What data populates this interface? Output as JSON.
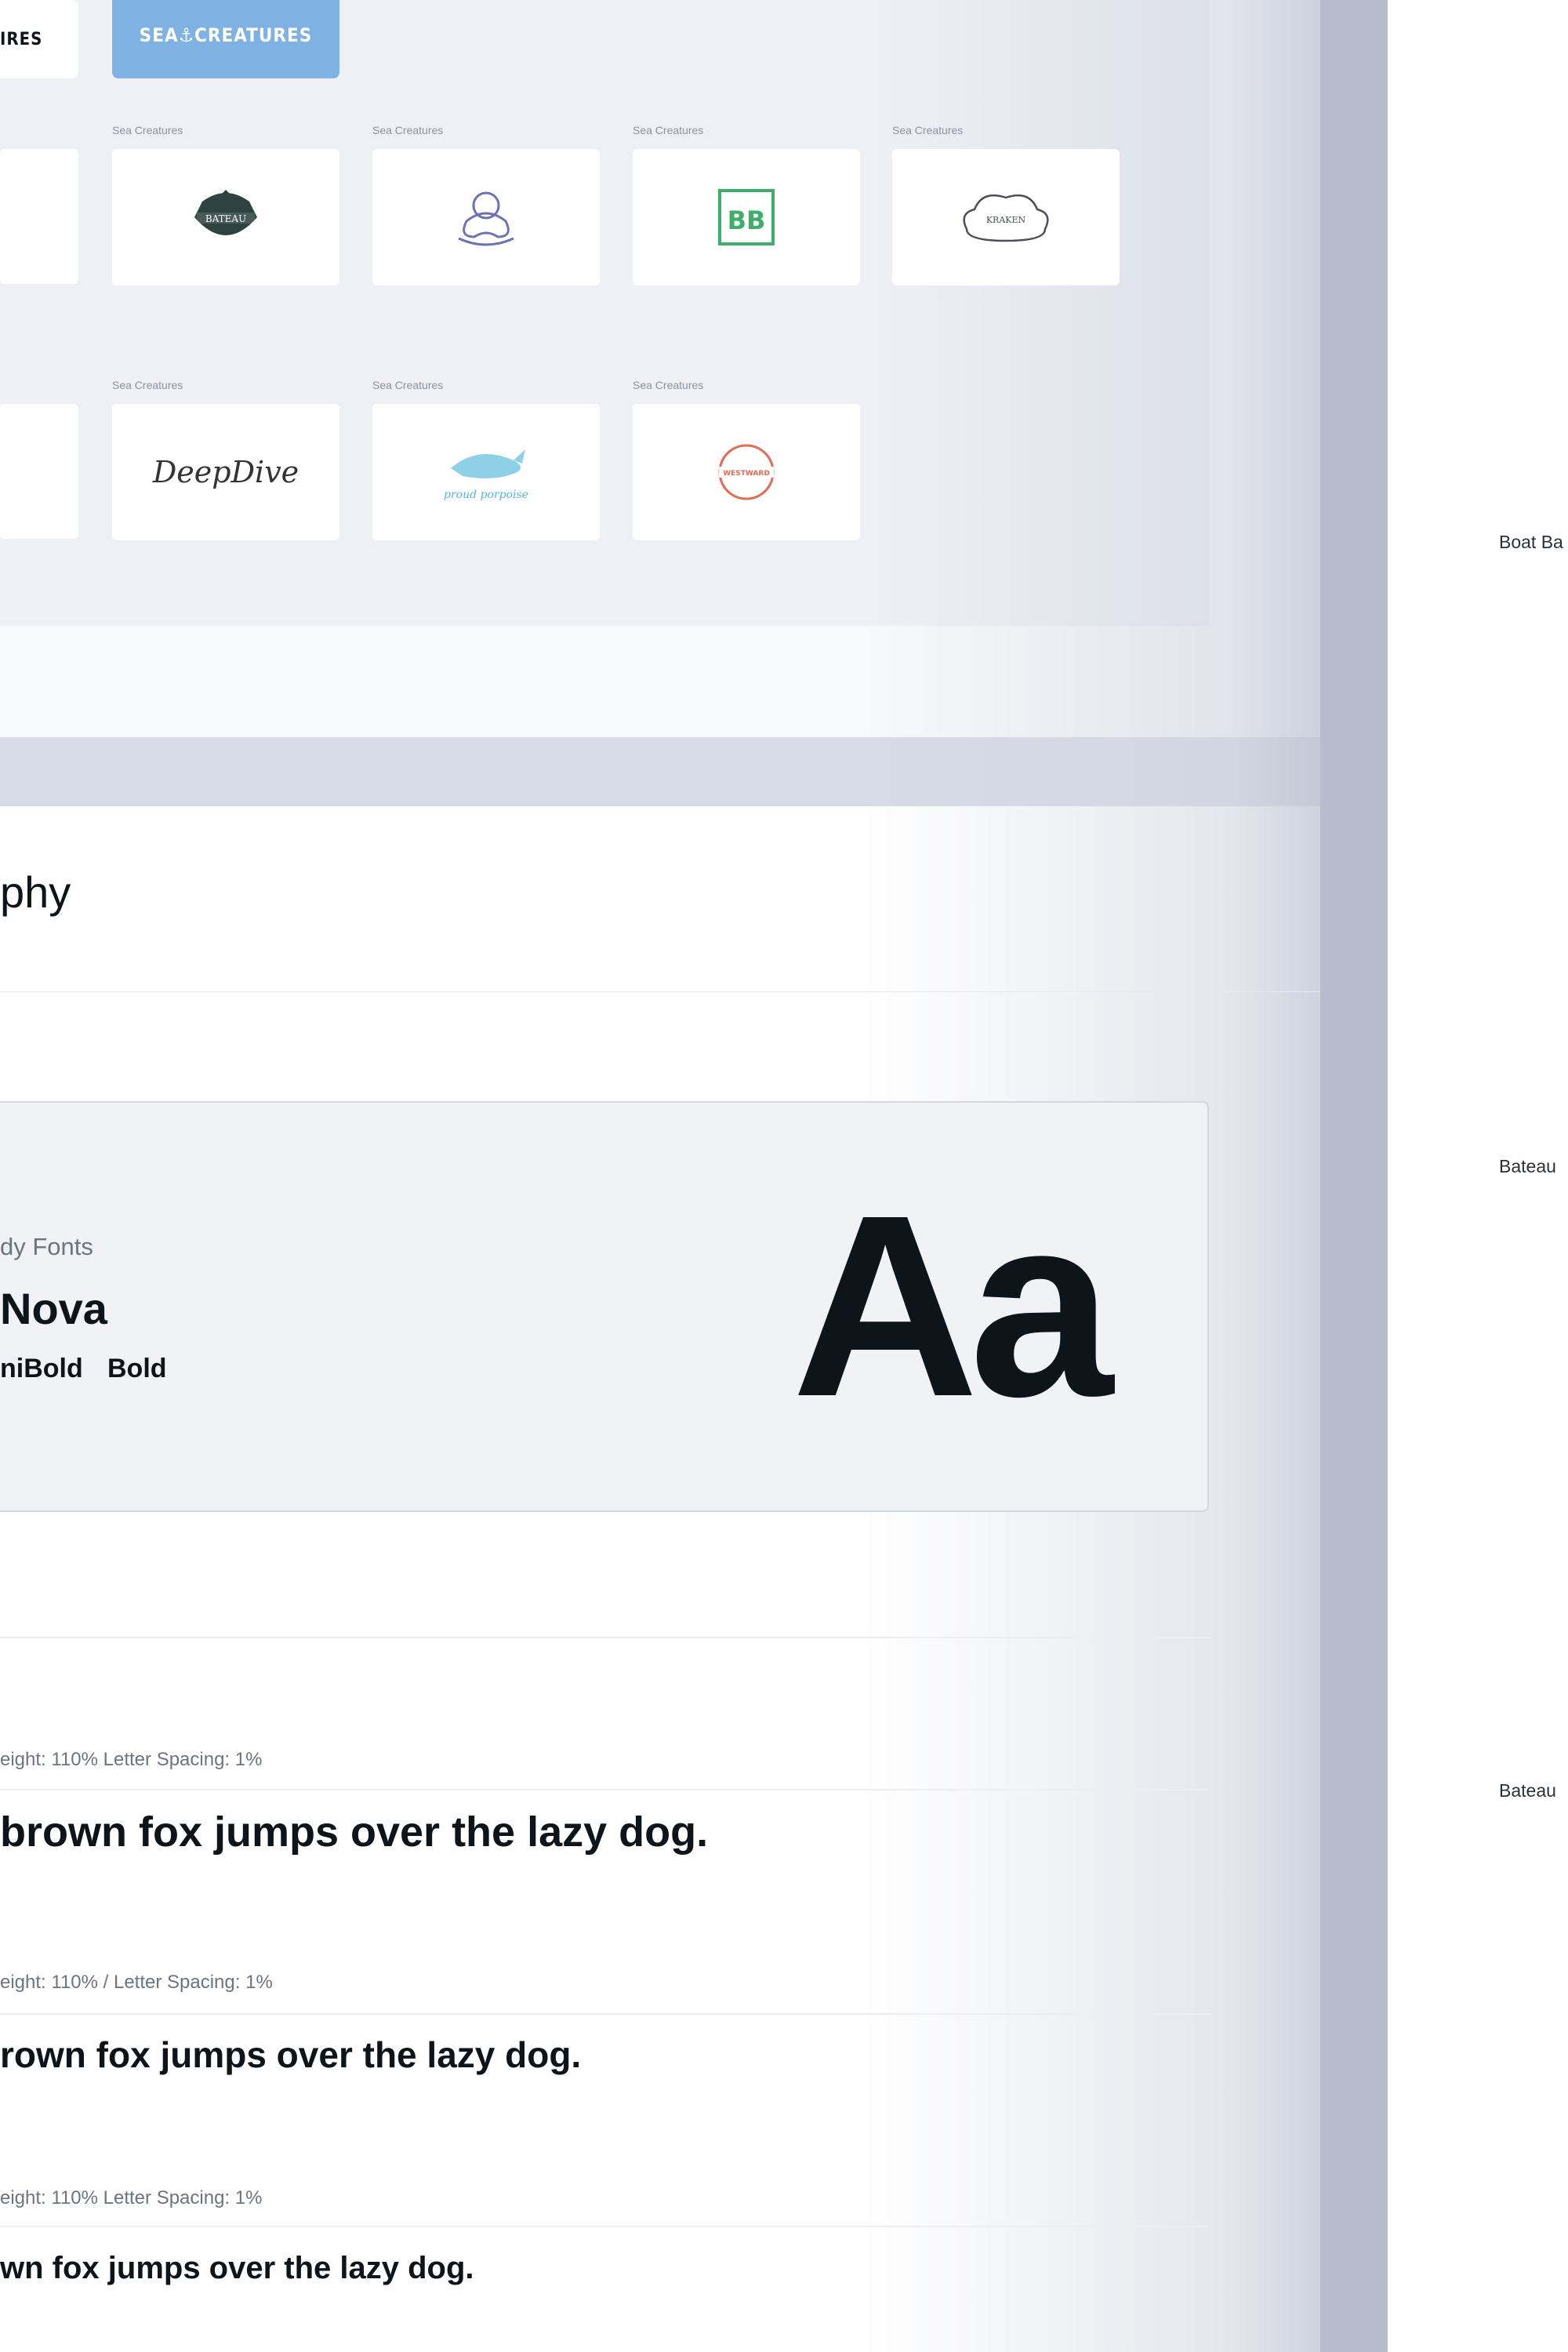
{
  "logos": {
    "tabs": {
      "previous": "IRES",
      "active": "SEA⚓CREATURES"
    },
    "row1": [
      {
        "label": "Sea Creatures",
        "logo": "BATEAU"
      },
      {
        "label": "Sea Creatures",
        "logo": "octopus-illustration"
      },
      {
        "label": "Sea Creatures",
        "logo": "BB"
      },
      {
        "label": "Sea Creatures",
        "logo": "KRAKEN"
      }
    ],
    "row2": [
      {
        "label": "Sea Creatures",
        "logo": "DeepDive"
      },
      {
        "label": "Sea Creatures",
        "logo": "proud porpoise"
      },
      {
        "label": "Sea Creatures",
        "logo": "WESTWARD"
      }
    ]
  },
  "typography": {
    "title": "phy",
    "font_category": "dy Fonts",
    "font_name": "Nova",
    "weights": [
      "niBold",
      "Bold"
    ],
    "specimen": "Aa",
    "samples": [
      {
        "spec": "eight: 110%  Letter Spacing: 1%",
        "text": "brown fox jumps over the lazy dog."
      },
      {
        "spec": "eight: 110%  /  Letter Spacing: 1%",
        "text": "rown fox jumps over the lazy dog."
      },
      {
        "spec": "eight: 110%  Letter Spacing: 1%",
        "text": "wn fox jumps over the lazy dog."
      }
    ]
  },
  "side_labels": [
    "Boat Ba",
    "Bateau",
    "Bateau"
  ],
  "colors": {
    "accent_blue": "#7db2e3",
    "rail": "#b7bccd",
    "ink": "#0d141a",
    "bb_green": "#3fae6a",
    "westward_red": "#e46b55"
  }
}
